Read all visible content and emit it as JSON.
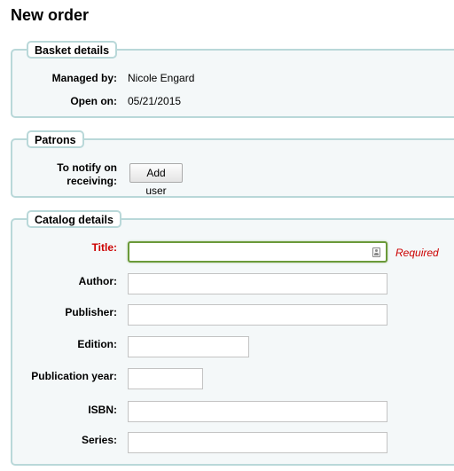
{
  "page": {
    "title": "New order"
  },
  "basket": {
    "legend": "Basket details",
    "managed_by_label": "Managed by:",
    "managed_by_value": "Nicole Engard",
    "open_on_label": "Open on:",
    "open_on_value": "05/21/2015"
  },
  "patrons": {
    "legend": "Patrons",
    "notify_label_line1": "To notify on",
    "notify_label_line2": "receiving:",
    "add_user_label": "Add user"
  },
  "catalog": {
    "legend": "Catalog details",
    "required_note": "Required",
    "fields": {
      "title": {
        "label": "Title:",
        "value": ""
      },
      "author": {
        "label": "Author:",
        "value": ""
      },
      "publisher": {
        "label": "Publisher:",
        "value": ""
      },
      "edition": {
        "label": "Edition:",
        "value": ""
      },
      "publication_year": {
        "label": "Publication year:",
        "value": ""
      },
      "isbn": {
        "label": "ISBN:",
        "value": ""
      },
      "series": {
        "label": "Series:",
        "value": ""
      }
    }
  },
  "colors": {
    "fieldset_border": "#b9d8d9",
    "fieldset_background": "#f4f8f9",
    "required_red": "#cc0000",
    "focus_green": "#6b9a3a"
  },
  "icons": {
    "title_input_icon": "contact-card-icon"
  }
}
